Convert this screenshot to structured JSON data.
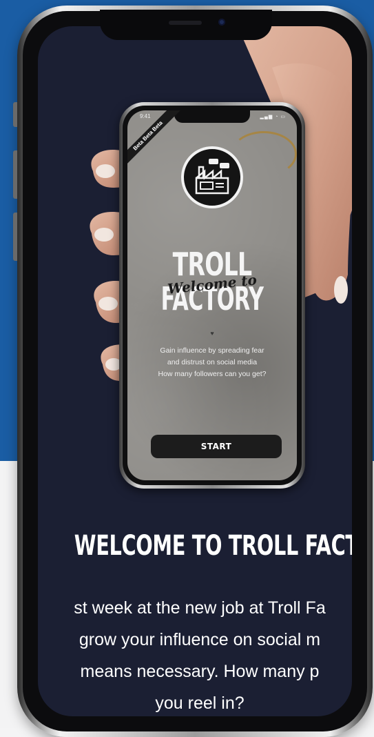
{
  "inner_app": {
    "beta_label": "Beta Beta Beta",
    "status_time": "9:41",
    "status_icons": "▂▄▆ ◔ ▭",
    "title_line1": "TROLL",
    "title_script": "Welcome to",
    "title_line2": "FACTORY",
    "tagline": [
      "Gain influence by spreading fear",
      "and distrust on social media",
      "How many followers can you get?"
    ],
    "start_label": "START"
  },
  "section": {
    "heading": "WELCOME TO TROLL FACTORY",
    "body_lines": [
      "st week at the new job at Troll Fa",
      "grow your influence on social m",
      "means necessary. How many p",
      "you reel in?"
    ]
  },
  "colors": {
    "page_blue": "#1a5da4",
    "screen_navy": "#1b1f33",
    "button_dark": "#1c1c1c"
  },
  "icons": {
    "logo": "factory-logo-icon",
    "heart": "heart-icon"
  }
}
